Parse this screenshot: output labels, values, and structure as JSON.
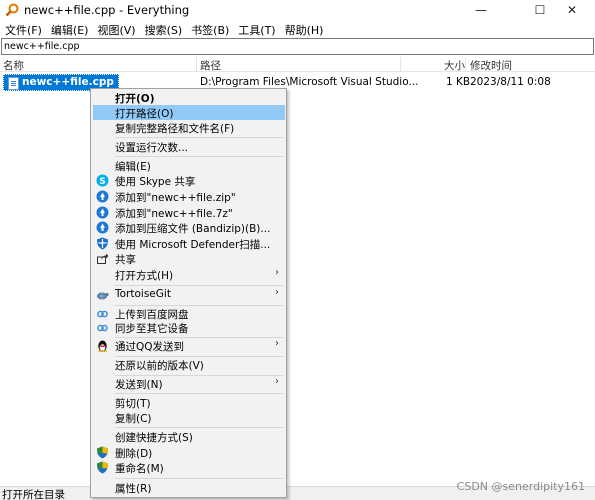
{
  "window": {
    "title": "newc++file.cpp - Everything",
    "minimize": "—",
    "maximize": "☐",
    "close": "✕"
  },
  "menubar": [
    "文件(F)",
    "编辑(E)",
    "视图(V)",
    "搜索(S)",
    "书签(B)",
    "工具(T)",
    "帮助(H)"
  ],
  "search": {
    "value": "newc++file.cpp"
  },
  "columns": {
    "name": "名称",
    "path": "路径",
    "size": "大小",
    "modified": "修改时间"
  },
  "file": {
    "name": "newc++file.cpp",
    "path": "D:\\Program Files\\Microsoft Visual Studio...",
    "size": "1 KB",
    "modified": "2023/8/11 0:08"
  },
  "context_menu": [
    "打开(O)",
    "打开路径(O)",
    "复制完整路径和文件名(F)",
    "设置运行次数...",
    "编辑(E)",
    "使用 Skype 共享",
    "添加到\"newc++file.zip\"",
    "添加到\"newc++file.7z\"",
    "添加到压缩文件 (Bandizip)(B)...",
    "使用 Microsoft Defender扫描...",
    "共享",
    "打开方式(H)",
    "TortoiseGit",
    "上传到百度网盘",
    "同步至其它设备",
    "通过QQ发送到",
    "还原以前的版本(V)",
    "发送到(N)",
    "剪切(T)",
    "复制(C)",
    "创建快捷方式(S)",
    "删除(D)",
    "重命名(M)",
    "属性(R)"
  ],
  "status": {
    "text": "打开所在目录"
  },
  "watermark": "CSDN @senerdipity161",
  "colors": {
    "selection": "#0078d7",
    "menu_highlight": "#91c9f7",
    "menu_bg": "#f2f2f2"
  }
}
